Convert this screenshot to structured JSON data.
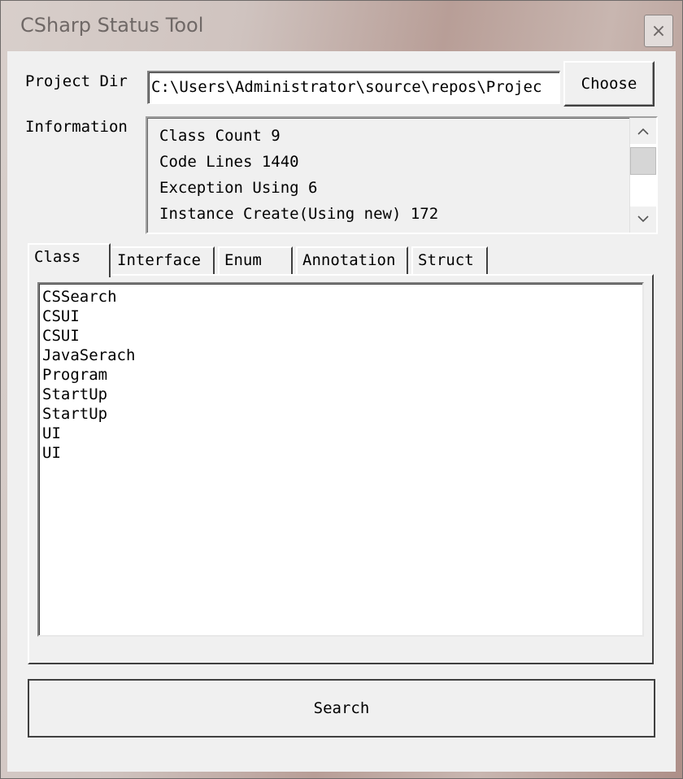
{
  "window": {
    "title": "CSharp Status Tool",
    "close_glyph": "×"
  },
  "project": {
    "label": "Project Dir",
    "path_value": "C:\\Users\\Administrator\\source\\repos\\Projec",
    "choose_label": "Choose"
  },
  "information": {
    "label": "Information",
    "lines": [
      "Class Count 9",
      "Code Lines 1440",
      "Exception Using 6",
      "Instance Create(Using new) 172"
    ],
    "scroll_up_icon": "chevron-up-icon",
    "scroll_down_icon": "chevron-down-icon"
  },
  "tabs": [
    {
      "label": "Class",
      "active": true
    },
    {
      "label": "Interface",
      "active": false
    },
    {
      "label": "Enum",
      "active": false
    },
    {
      "label": "Annotation",
      "active": false
    },
    {
      "label": "Struct",
      "active": false
    }
  ],
  "class_list": [
    "CSSearch",
    "CSUI",
    "CSUI",
    "JavaSerach",
    "Program",
    "StartUp",
    "StartUp",
    "UI",
    "UI"
  ],
  "search_label": "Search",
  "colors": {
    "client_bg": "#f0f0f0",
    "field_bg": "#ffffff",
    "title_text": "#6f6866"
  }
}
